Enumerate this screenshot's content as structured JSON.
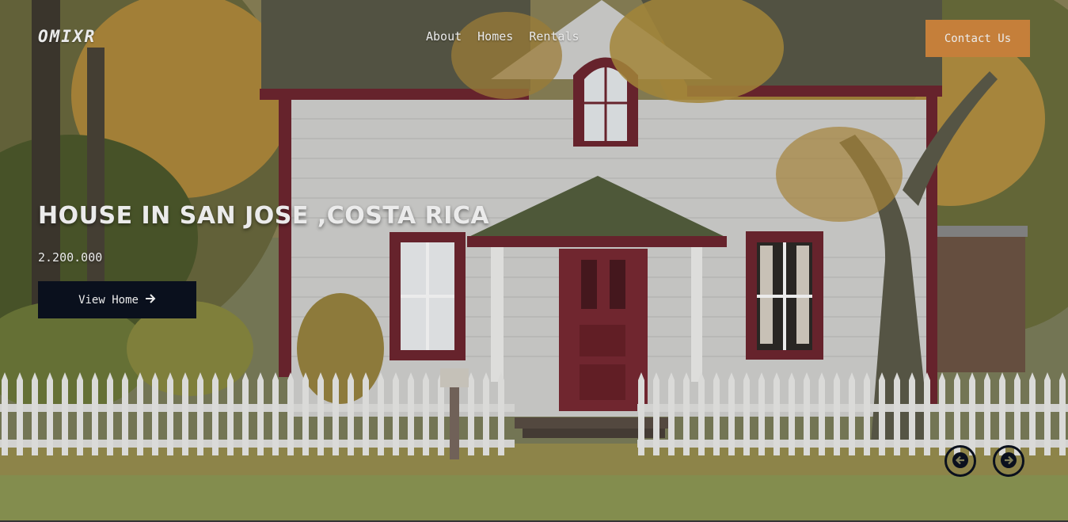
{
  "brand": {
    "logo": "OMIXR"
  },
  "nav": {
    "items": [
      {
        "label": "About"
      },
      {
        "label": "Homes"
      },
      {
        "label": "Rentals"
      }
    ],
    "contact_label": "Contact Us"
  },
  "hero": {
    "title": "HOUSE IN SAN JOSE ,COSTA RICA",
    "price": "2.200.000",
    "cta_label": "View Home",
    "cta_icon": "arrow-right-icon",
    "image_subject": "white-house-with-red-trim-picket-fence-autumn"
  },
  "slider": {
    "prev_icon": "arrow-left-circle-icon",
    "next_icon": "arrow-right-circle-icon"
  },
  "colors": {
    "accent": "#d68a3f",
    "dark": "#0b1220",
    "house_trim": "#7a2a33",
    "text": "#ffffff"
  }
}
